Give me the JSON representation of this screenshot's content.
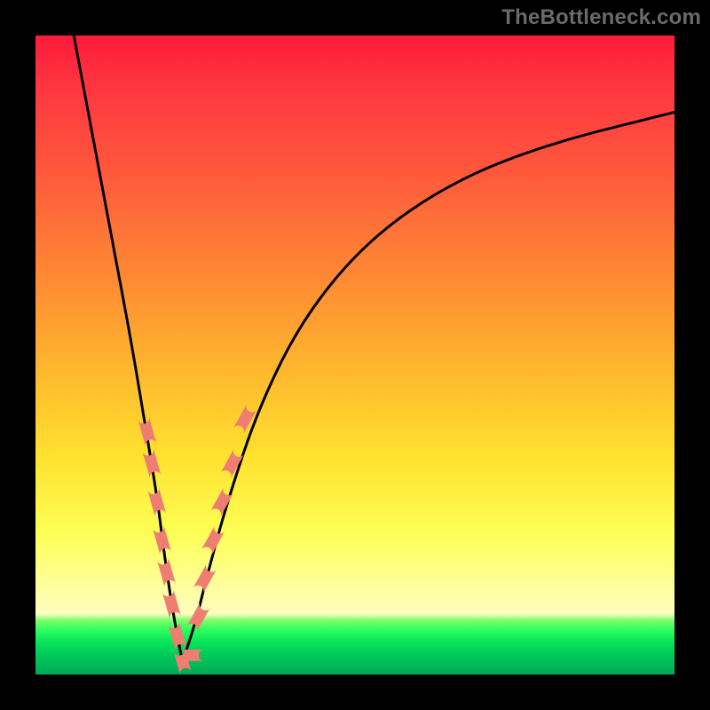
{
  "watermark": "TheBottleneck.com",
  "colors": {
    "frame": "#000000",
    "curve": "#000000",
    "bead": "#ee7d72"
  },
  "chart_data": {
    "type": "line",
    "title": "",
    "xlabel": "",
    "ylabel": "",
    "xlim": [
      0,
      100
    ],
    "ylim": [
      0,
      100
    ],
    "grid": false,
    "legend": false,
    "note": "Axes not labeled in image; 0–100 assumed for both. y represents bottleneck percentage (higher = worse). Curve is V-shaped with minimum near x≈23.",
    "series": [
      {
        "name": "left-branch",
        "x": [
          6,
          9,
          12,
          15,
          17,
          19,
          20,
          21,
          22,
          23
        ],
        "y": [
          100,
          84,
          68,
          52,
          40,
          28,
          20,
          13,
          7,
          2
        ]
      },
      {
        "name": "right-branch",
        "x": [
          23,
          25,
          27,
          30,
          35,
          42,
          52,
          65,
          80,
          100
        ],
        "y": [
          2,
          8,
          16,
          27,
          42,
          56,
          68,
          77,
          83,
          88
        ]
      }
    ],
    "beads_note": "Salmon capsule markers clustered near valley on both branches, roughly y in [5,40].",
    "beads": [
      {
        "branch": "left",
        "x": 17.5,
        "y": 38
      },
      {
        "branch": "left",
        "x": 18.2,
        "y": 33
      },
      {
        "branch": "left",
        "x": 19.0,
        "y": 27
      },
      {
        "branch": "left",
        "x": 19.8,
        "y": 21
      },
      {
        "branch": "left",
        "x": 20.5,
        "y": 16
      },
      {
        "branch": "left",
        "x": 21.3,
        "y": 11
      },
      {
        "branch": "left",
        "x": 22.2,
        "y": 6
      },
      {
        "branch": "left-floor",
        "x": 23.0,
        "y": 2
      },
      {
        "branch": "right-floor",
        "x": 24.5,
        "y": 3
      },
      {
        "branch": "right",
        "x": 25.5,
        "y": 9
      },
      {
        "branch": "right",
        "x": 26.5,
        "y": 15
      },
      {
        "branch": "right",
        "x": 27.8,
        "y": 21
      },
      {
        "branch": "right",
        "x": 29.2,
        "y": 27
      },
      {
        "branch": "right",
        "x": 30.8,
        "y": 33
      },
      {
        "branch": "right",
        "x": 32.8,
        "y": 40
      }
    ]
  }
}
